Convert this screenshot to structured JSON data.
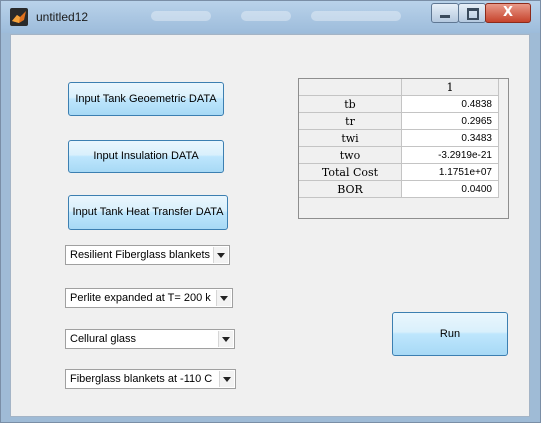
{
  "window": {
    "title": "untitled12",
    "close_label": "X"
  },
  "buttons": {
    "geometric": "Input Tank Geoemetric DATA",
    "insulation": "Input Insulation DATA",
    "heat_transfer": "Input Tank Heat Transfer DATA",
    "run": "Run"
  },
  "popups": [
    "Resilient Fiberglass blankets ...",
    "Perlite expanded at T= 200 k",
    "Cellural glass",
    "Fiberglass blankets at -110 C"
  ],
  "table": {
    "column_header": "1",
    "rows": [
      {
        "label": "tb",
        "value": "0.4838"
      },
      {
        "label": "tr",
        "value": "0.2965"
      },
      {
        "label": "twi",
        "value": "0.3483"
      },
      {
        "label": "two",
        "value": "-3.2919e-21"
      },
      {
        "label": "Total Cost",
        "value": "1.1751e+07"
      },
      {
        "label": "BOR",
        "value": "0.0400"
      }
    ]
  },
  "colors": {
    "button_border": "#3c7fb1",
    "titlebar": "#b9d2ea",
    "close_button": "#c6432c"
  }
}
